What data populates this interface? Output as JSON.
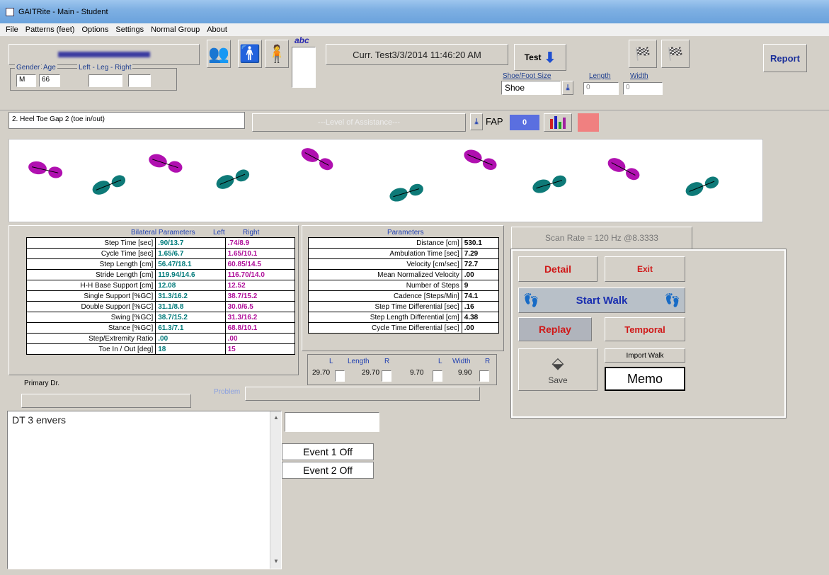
{
  "window": {
    "title": "GAITRite - Main - Student"
  },
  "menu": [
    "File",
    "Patterns (feet)",
    "Options",
    "Settings",
    "Normal Group",
    "About"
  ],
  "patient": {
    "gender_label": "Gender",
    "age_label": "Age",
    "leg_label": "Left - Leg - Right",
    "gender": "M",
    "age": "66",
    "leg_left": "",
    "leg_right": ""
  },
  "header": {
    "abc_label": "abc",
    "curr_test": "Curr. Test3/3/2014 11:46:20 AM",
    "test_label": "Test",
    "shoe_label": "Shoe/Foot Size",
    "shoe_value": "Shoe",
    "length_label": "Length",
    "length_value": "0",
    "width_label": "Width",
    "width_value": "0",
    "report_label": "Report"
  },
  "test": {
    "title": "2. Heel Toe Gap 2 (toe in/out)",
    "loa_placeholder": "---Level of Assistance---",
    "fap_label": "FAP",
    "fap_value": "0"
  },
  "footprints": {
    "left_color": "#b010b0",
    "right_color": "#0e7a78"
  },
  "bilateral": {
    "title": "Bilateral Parameters",
    "left_head": "Left",
    "right_head": "Right",
    "rows": [
      {
        "label": "Step Time [sec]",
        "left": ".90/13.7",
        "right": ".74/8.9"
      },
      {
        "label": "Cycle Time [sec]",
        "left": "1.65/6.7",
        "right": "1.65/10.1"
      },
      {
        "label": "Step Length [cm]",
        "left": "56.47/18.1",
        "right": "60.85/14.5"
      },
      {
        "label": "Stride Length [cm]",
        "left": "119.94/14.6",
        "right": "116.70/14.0"
      },
      {
        "label": "H-H Base Support [cm]",
        "left": "12.08",
        "right": "12.52"
      },
      {
        "label": "Single Support [%GC]",
        "left": "31.3/16.2",
        "right": "38.7/15.2"
      },
      {
        "label": "Double Support [%GC]",
        "left": "31.1/8.8",
        "right": "30.0/6.5"
      },
      {
        "label": "Swing [%GC]",
        "left": "38.7/15.2",
        "right": "31.3/16.2"
      },
      {
        "label": "Stance [%GC]",
        "left": "61.3/7.1",
        "right": "68.8/10.1"
      },
      {
        "label": "Step/Extremity Ratio",
        "left": ".00",
        "right": ".00"
      },
      {
        "label": "Toe In / Out [deg]",
        "left": "18",
        "right": "15"
      }
    ]
  },
  "parameters": {
    "title": "Parameters",
    "rows": [
      {
        "label": "Distance [cm]",
        "value": "530.1"
      },
      {
        "label": "Ambulation Time [sec]",
        "value": "7.29"
      },
      {
        "label": "Velocity [cm/sec]",
        "value": "72.7"
      },
      {
        "label": "Mean Normalized Velocity",
        "value": ".00"
      },
      {
        "label": "Number of Steps",
        "value": "9"
      },
      {
        "label": "Cadence [Steps/Min]",
        "value": "74.1"
      },
      {
        "label": "Step Time Differential [sec]",
        "value": ".16"
      },
      {
        "label": "Step Length Differential [cm]",
        "value": "4.38"
      },
      {
        "label": "Cycle Time Differential [sec]",
        "value": ".00"
      }
    ]
  },
  "leglength": {
    "l": "L",
    "length": "Length",
    "r": "R",
    "l2": "L",
    "width": "Width",
    "r2": "R",
    "v1": "29.70",
    "v2": "29.70",
    "v3": "9.70",
    "v4": "9.90"
  },
  "primary_dr_label": "Primary Dr.",
  "problem_label": "Problem",
  "notes": "DT 3 envers",
  "events": [
    "Event 1 Off",
    "Event 2 Off"
  ],
  "scan_rate": "Scan Rate = 120 Hz @8.3333",
  "actions": {
    "detail": "Detail",
    "exit": "Exit",
    "start_walk": "Start Walk",
    "replay": "Replay",
    "temporal": "Temporal",
    "import_walk": "Import Walk",
    "save": "Save",
    "memo": "Memo"
  }
}
